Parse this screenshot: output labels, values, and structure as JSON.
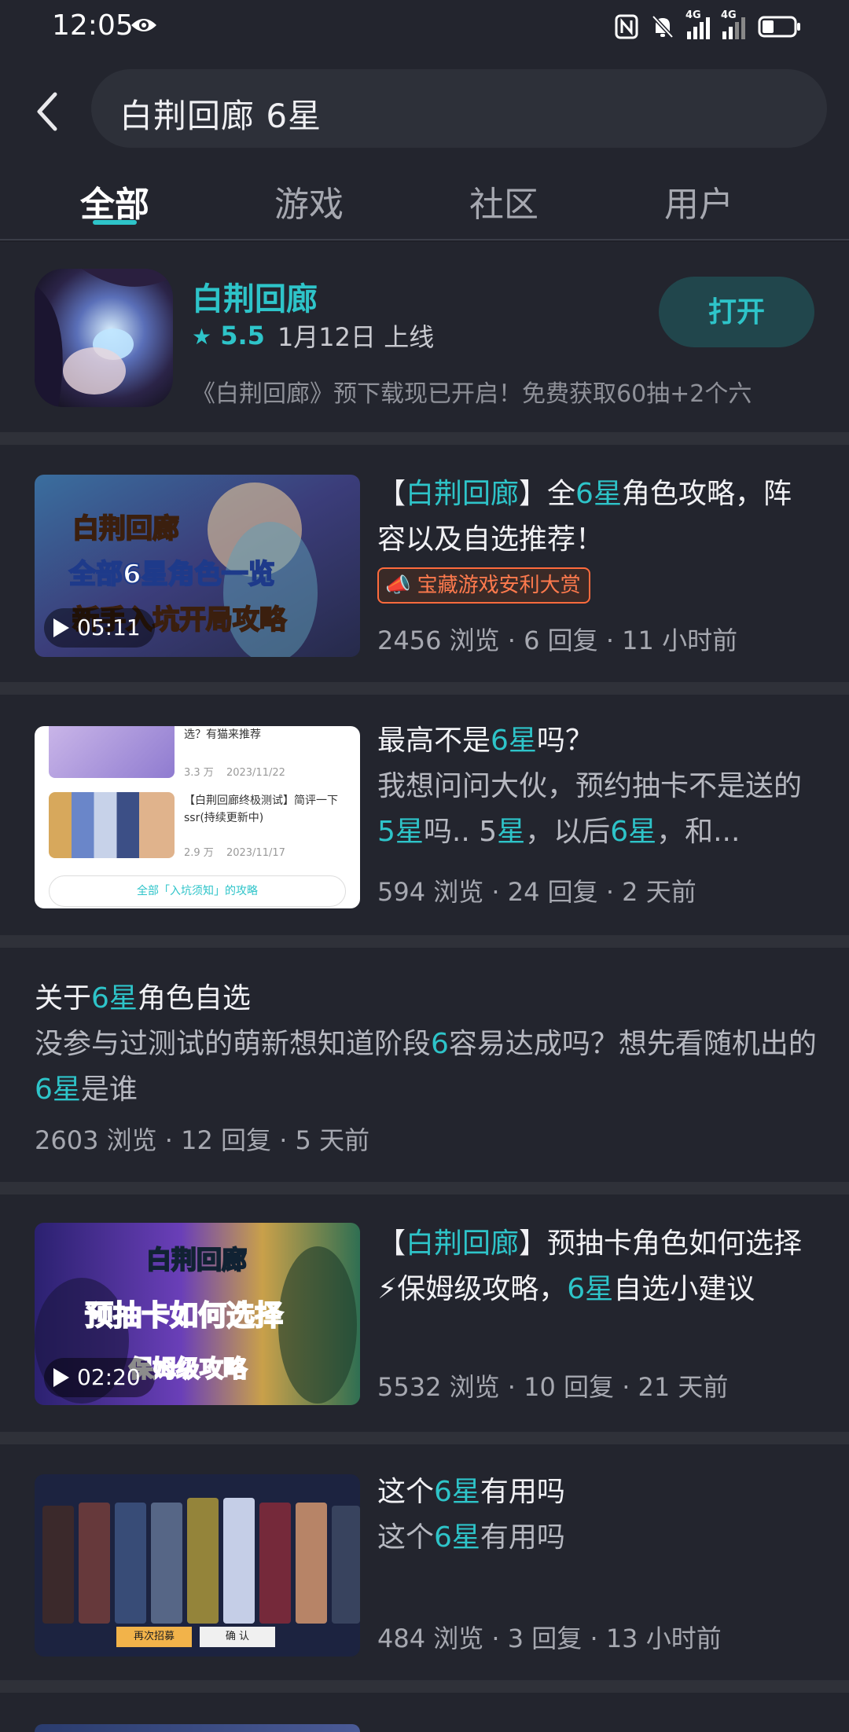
{
  "status_bar": {
    "time": "12:05",
    "network_1": "4G",
    "network_2": "4G"
  },
  "search": {
    "query": "白荆回廊 6星"
  },
  "tabs": [
    {
      "label": "全部",
      "active": true
    },
    {
      "label": "游戏",
      "active": false
    },
    {
      "label": "社区",
      "active": false
    },
    {
      "label": "用户",
      "active": false
    }
  ],
  "game": {
    "name": "白荆回廊",
    "rating": "5.5",
    "launch": "1月12日 上线",
    "description": "《白荆回廊》预下载现已开启！免费获取60抽+2个六",
    "open_label": "打开"
  },
  "posts": [
    {
      "title_parts": [
        "【",
        "白荆回廊",
        "】全",
        "6星",
        "角色攻略，阵容以及自选推荐！"
      ],
      "badge": "宝藏游戏安利大赏",
      "duration": "05:11",
      "stats": "2456 浏览 · 6 回复 · 11 小时前"
    },
    {
      "title_parts": [
        "最高不是",
        "6星",
        "吗？"
      ],
      "excerpt_parts": [
        "我想问问大伙，预约抽卡不是送的",
        "5星",
        "吗.. 5",
        "星",
        "，以后",
        "6星",
        "，和..."
      ],
      "thumb_rows": [
        {
          "title": "【白荆回廊终极测试】简评一下ssr(持续更新中)",
          "views": "2.9 万",
          "date": "2023/11/17"
        },
        {
          "title": "选？有猫来推荐",
          "views": "3.3 万",
          "date": "2023/11/22"
        }
      ],
      "thumb_footer": "全部「入坑须知」的攻略",
      "stats": "594 浏览 · 24 回复 · 2 天前"
    },
    {
      "title_parts": [
        "关于",
        "6星",
        "角色自选"
      ],
      "excerpt_parts": [
        "没参与过测试的萌新想知道阶段",
        "6",
        "容易达成吗？想先看随机出的",
        "6星",
        "是谁"
      ],
      "stats": "2603 浏览 · 12 回复 · 5 天前"
    },
    {
      "title_parts": [
        "【",
        "白荆回廊",
        "】预抽卡角色如何选择⚡保姆级攻略，",
        "6星",
        "自选小建议"
      ],
      "duration": "02:20",
      "stats": "5532 浏览 · 10 回复 · 21 天前"
    },
    {
      "title_parts": [
        "这个",
        "6星",
        "有用吗"
      ],
      "excerpt_parts": [
        "这个",
        "6星",
        "有用吗"
      ],
      "thumb_buttons": [
        "再次招募",
        "确 认"
      ],
      "stats": "484 浏览 · 3 回复 · 13 小时前"
    }
  ],
  "thumb_overlays": {
    "post1": [
      "白荆回廊",
      "全部6星角色一览",
      "新手入坑开局攻略"
    ],
    "post4": [
      "白荆回廊",
      "预抽卡如何选择",
      "保姆级攻略"
    ]
  },
  "colors": {
    "accent": "#2ec4c9",
    "background": "#1f2129",
    "card": "#23252e",
    "badge": "#ff6b3d"
  },
  "icons": [
    "eye-icon",
    "nfc-icon",
    "bell-off-icon",
    "signal-icon",
    "battery-icon",
    "back-arrow-icon",
    "star-icon",
    "megaphone-icon",
    "play-icon"
  ]
}
